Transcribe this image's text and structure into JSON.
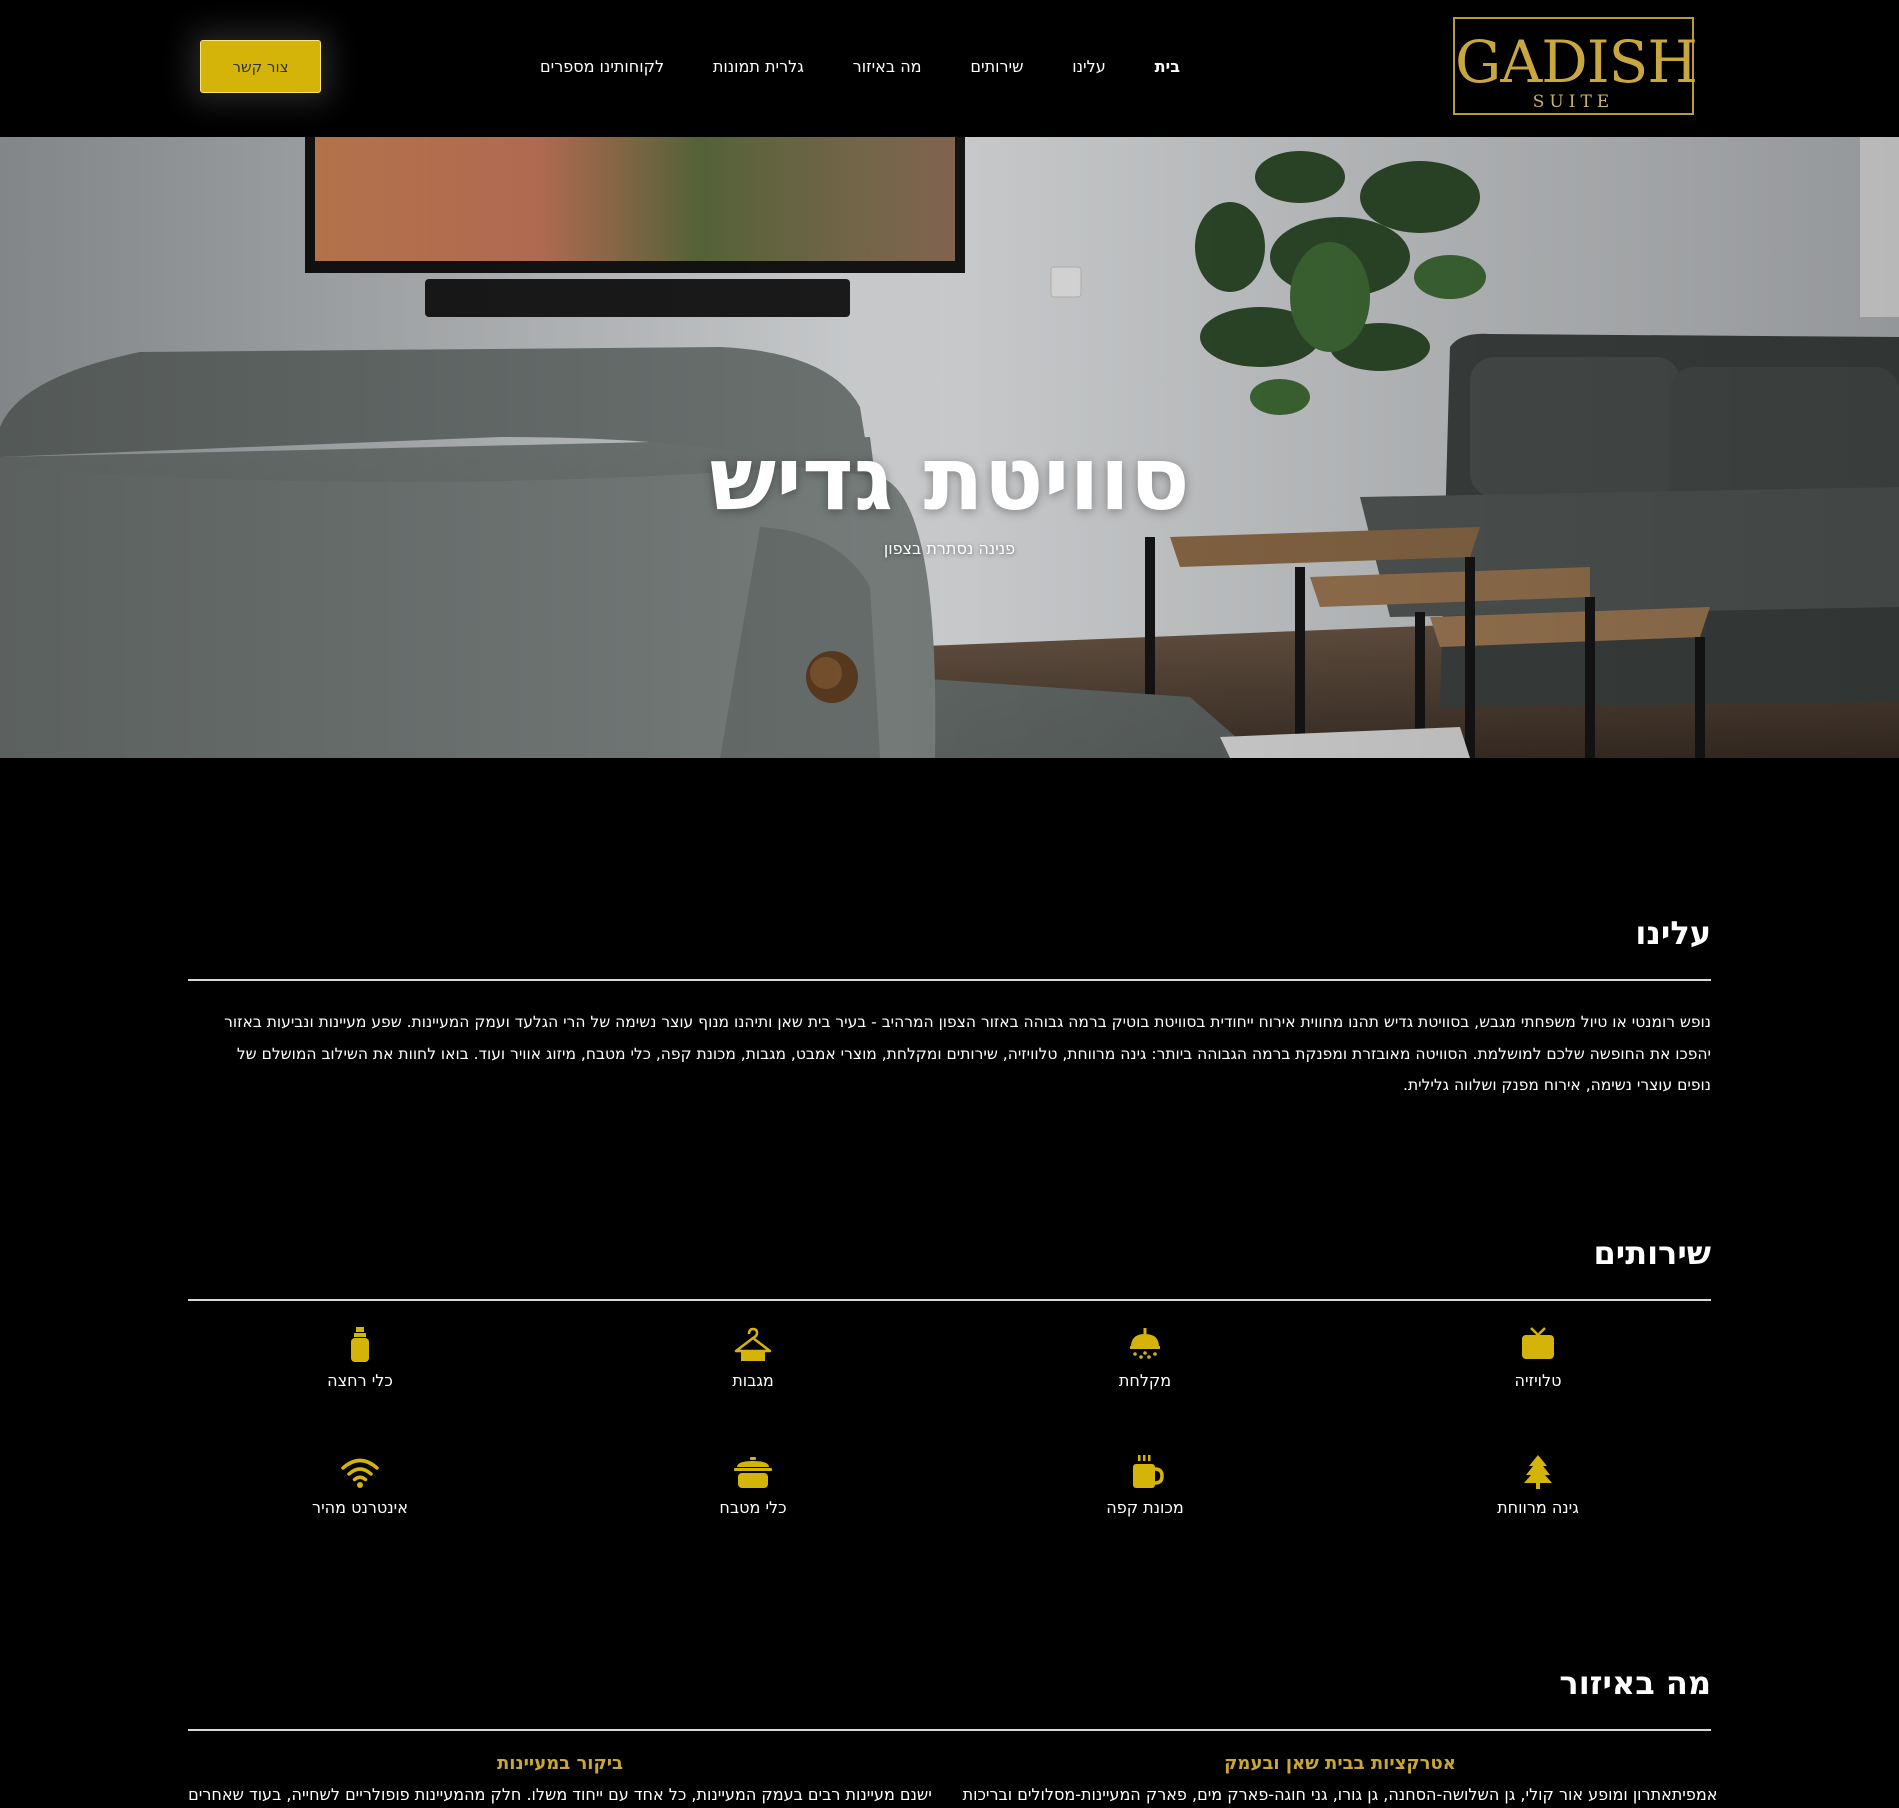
{
  "header": {
    "logo_main": "GADISH",
    "logo_sub": "SUITE",
    "nav": [
      {
        "label": "בית",
        "active": true
      },
      {
        "label": "עלינו"
      },
      {
        "label": "שירותים"
      },
      {
        "label": "מה באיזור"
      },
      {
        "label": "גלרית תמונות"
      },
      {
        "label": "לקוחותינו מספרים"
      }
    ],
    "contact_label": "צור קשר"
  },
  "hero": {
    "title": "סוויטת גדיש",
    "subtitle": "פנינה נסתרת בצפון"
  },
  "about": {
    "title": "עלינו",
    "text": "נופש רומנטי או טיול משפחתי מגבש, בסוויטת גדיש תהנו מחווית אירוח ייחודית בסוויטת בוטיק ברמה גבוהה באזור הצפון המרהיב - בעיר בית שאן ותיהנו מנוף עוצר נשימה של הרי הגלעד ועמק המעיינות. שפע מעיינות ונביעות באזור יהפכו את החופשה שלכם למושלמת. הסוויטה מאובזרת ומפנקת ברמה הגבוהה ביותר: גינה מרווחת, טלוויזיה, שירותים ומקלחת, מוצרי אמבט, מגבות, מכונת קפה, כלי מטבח, מיזוג אוויר ועוד. בואו לחוות את השילוב המושלם של נופים עוצרי נשימה, אירוח מפנק ושלווה גלילית."
  },
  "services": {
    "title": "שירותים",
    "accent_color": "#d4b409",
    "items": [
      {
        "label": "טלויזיה",
        "icon": "tv-icon"
      },
      {
        "label": "מקלחת",
        "icon": "shower-icon"
      },
      {
        "label": "מגבות",
        "icon": "hanger-icon"
      },
      {
        "label": "כלי רחצה",
        "icon": "toiletries-icon"
      },
      {
        "label": "גינה מרווחת",
        "icon": "tree-icon"
      },
      {
        "label": "מכונת קפה",
        "icon": "coffee-mug-icon"
      },
      {
        "label": "כלי מטבח",
        "icon": "cooking-pot-icon"
      },
      {
        "label": "אינטרנט מהיר",
        "icon": "wifi-icon"
      }
    ]
  },
  "area": {
    "title": "מה באיזור",
    "accent_color": "#c9a737",
    "items": [
      {
        "heading": "אטרקציות בבית שאן ובעמק",
        "text": "אמפיתאתרון ומופע אור קולי, גן השלושה-הסחנה, גן גורו, גני חוגה-פארק מים, פארק המעיינות-מסלולים ובריכות"
      },
      {
        "heading": "ביקור במעיינות",
        "text": "ישנם מעיינות רבים בעמק המעיינות, כל אחד עם ייחוד משלו. חלק מהמעיינות פופולריים לשחייה, בעוד שאחרים"
      }
    ]
  }
}
